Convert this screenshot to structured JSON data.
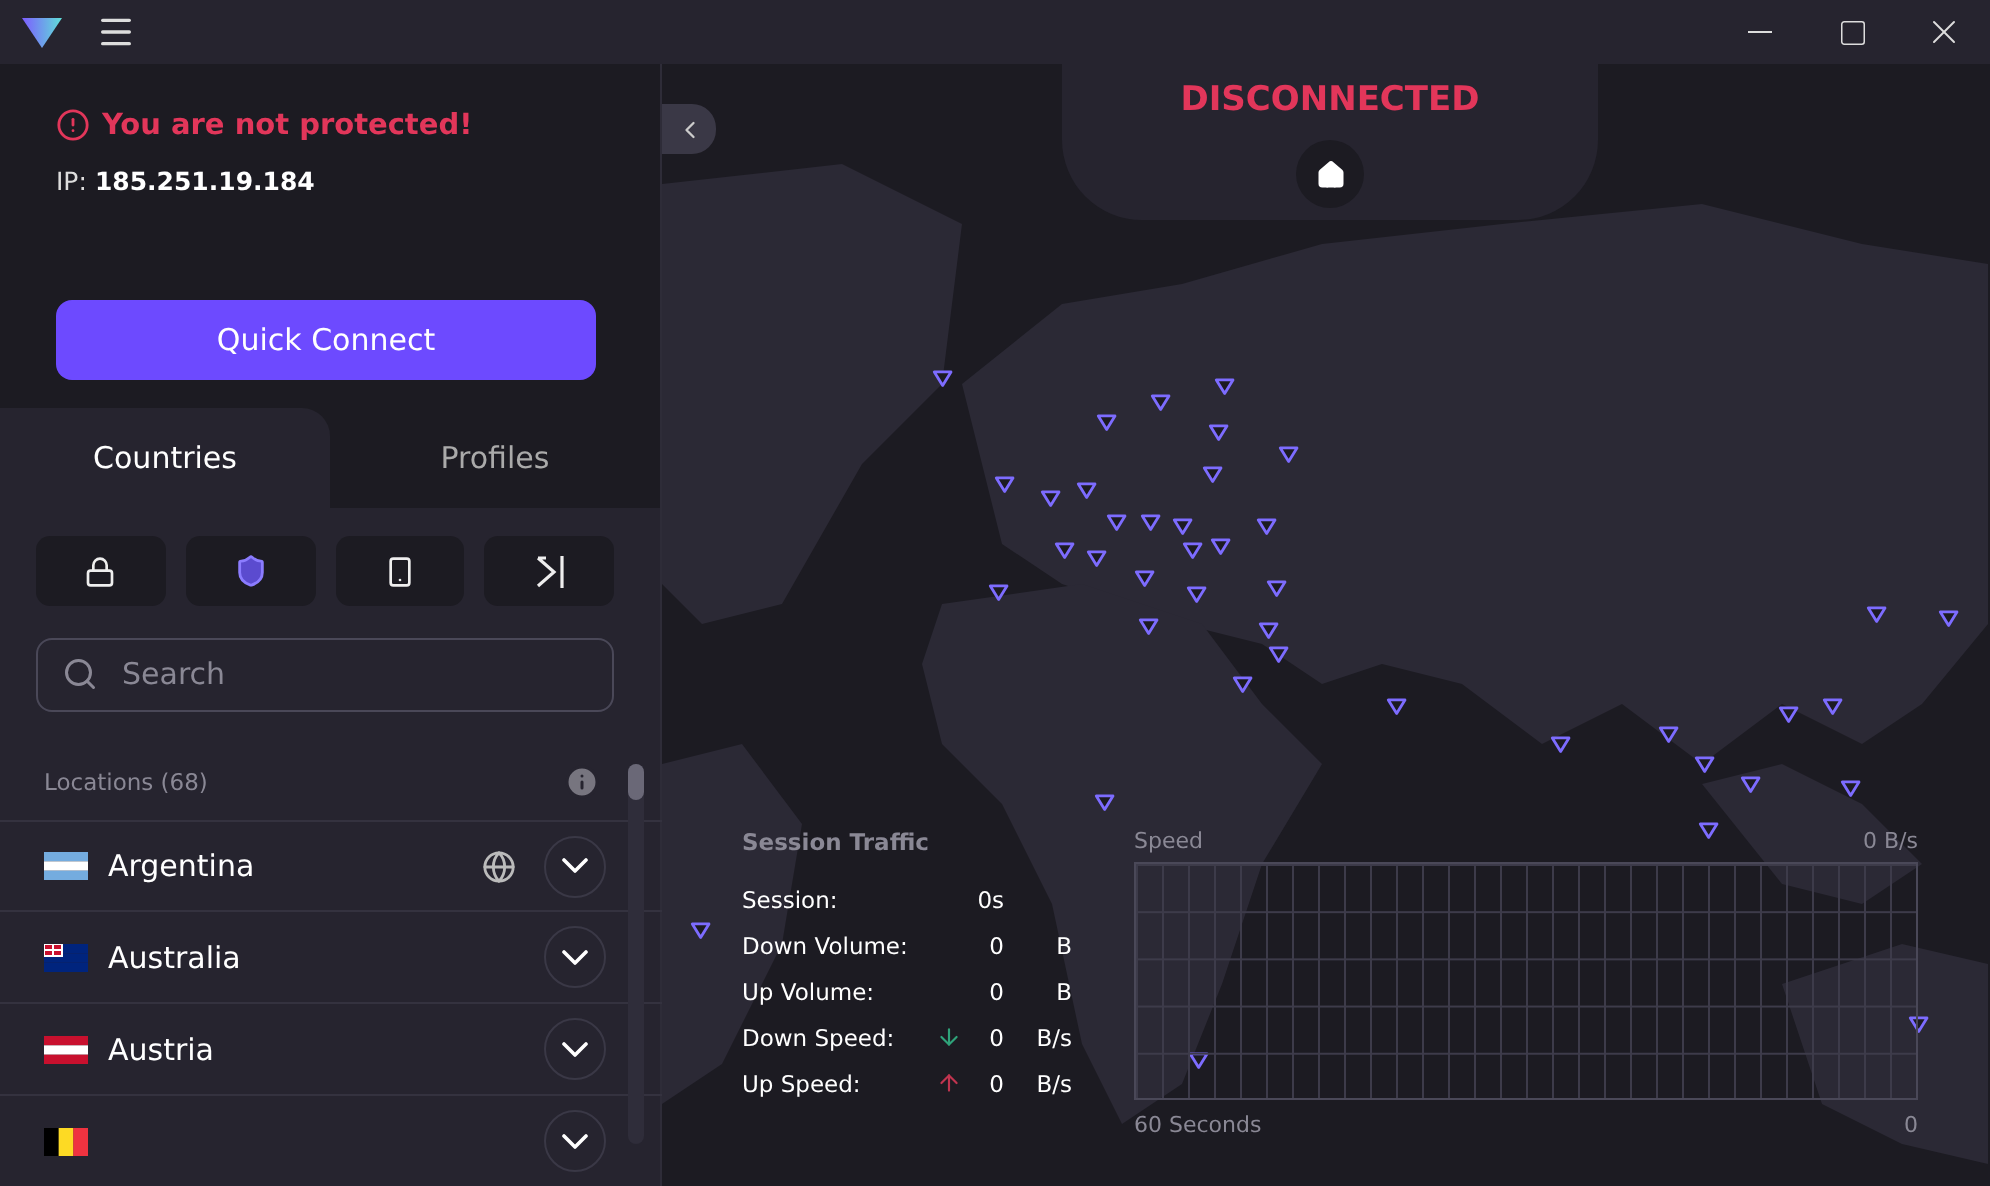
{
  "status": {
    "message": "You are not protected!",
    "ip_label": "IP:",
    "ip": "185.251.19.184"
  },
  "quick_connect": {
    "label": "Quick Connect"
  },
  "tabs": [
    {
      "label": "Countries",
      "selected": true
    },
    {
      "label": "Profiles",
      "selected": false
    }
  ],
  "filters": [
    {
      "kind": "lock"
    },
    {
      "kind": "shield"
    },
    {
      "kind": "phone"
    },
    {
      "kind": "arrow"
    }
  ],
  "search": {
    "placeholder": "Search"
  },
  "locations": {
    "title": "Locations (68)",
    "items": [
      {
        "name": "Argentina",
        "kind": "ar",
        "globe": true
      },
      {
        "name": "Australia",
        "kind": "au",
        "globe": false
      },
      {
        "name": "Austria",
        "kind": "at",
        "globe": false
      },
      {
        "kind": "be",
        "globe": false
      }
    ]
  },
  "connection": {
    "state": "DISCONNECTED"
  },
  "session_traffic": {
    "title": "Session Traffic",
    "rows": [
      {
        "label": "Session:",
        "value": "0s",
        "kind": "plain"
      },
      {
        "label": "Down Volume:",
        "value": "0",
        "unit": "B",
        "kind": "plain"
      },
      {
        "label": "Up Volume:",
        "value": "0",
        "unit": "B",
        "kind": "plain"
      },
      {
        "label": "Down Speed:",
        "value": "0",
        "unit": "B/s",
        "kind": "down"
      },
      {
        "label": "Up Speed:",
        "value": "0",
        "unit": "B/s",
        "kind": "up"
      }
    ]
  },
  "speed_graph": {
    "title": "Speed",
    "max": "0 B/s",
    "x_label": "60 Seconds",
    "x_end": "0"
  }
}
